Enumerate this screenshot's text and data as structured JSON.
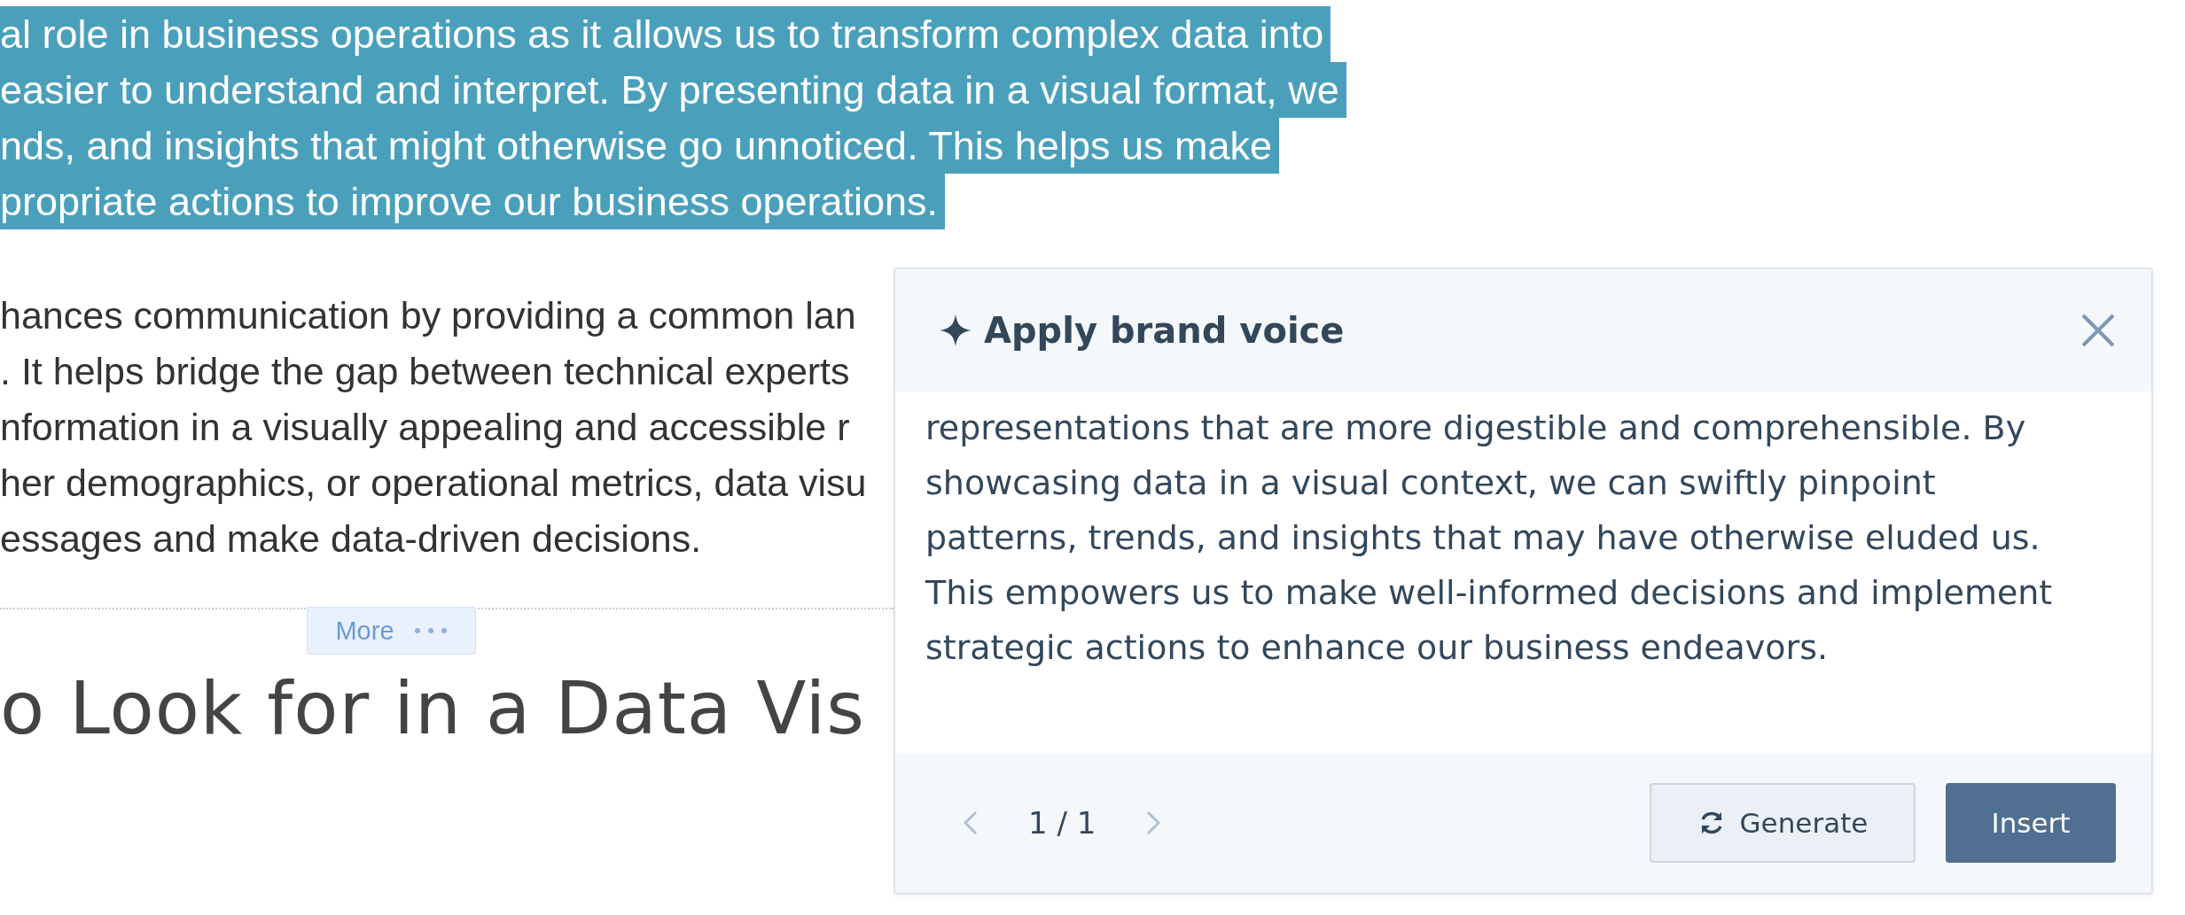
{
  "document": {
    "paragraphs": [
      {
        "selected": true,
        "lines": [
          "al role in business operations as it allows us to transform complex data into",
          "easier to understand and interpret. By presenting data in a visual format, we",
          "nds, and insights that might otherwise go unnoticed. This helps us make",
          "propriate actions to improve our business operations."
        ]
      },
      {
        "selected": false,
        "lines": [
          "hances communication by providing a common lan",
          ". It helps bridge the gap between technical experts",
          "nformation in a visually appealing and accessible r",
          "her demographics, or operational metrics, data visu",
          "essages and make data-driven decisions."
        ]
      }
    ],
    "more_button": {
      "label": "More"
    },
    "heading": "o Look for in a Data Vis"
  },
  "dialog": {
    "title": "Apply brand voice",
    "body": "representations that are more digestible and comprehensible. By showcasing data in a visual context, we can swiftly pinpoint patterns, trends, and insights that may have otherwise eluded us. This empowers us to make well-informed decisions and implement strategic actions to enhance our business endeavors.",
    "pager": "1 / 1",
    "buttons": [
      {
        "label": "Generate",
        "kind": "secondary"
      },
      {
        "label": "Insert",
        "kind": "primary"
      }
    ]
  }
}
